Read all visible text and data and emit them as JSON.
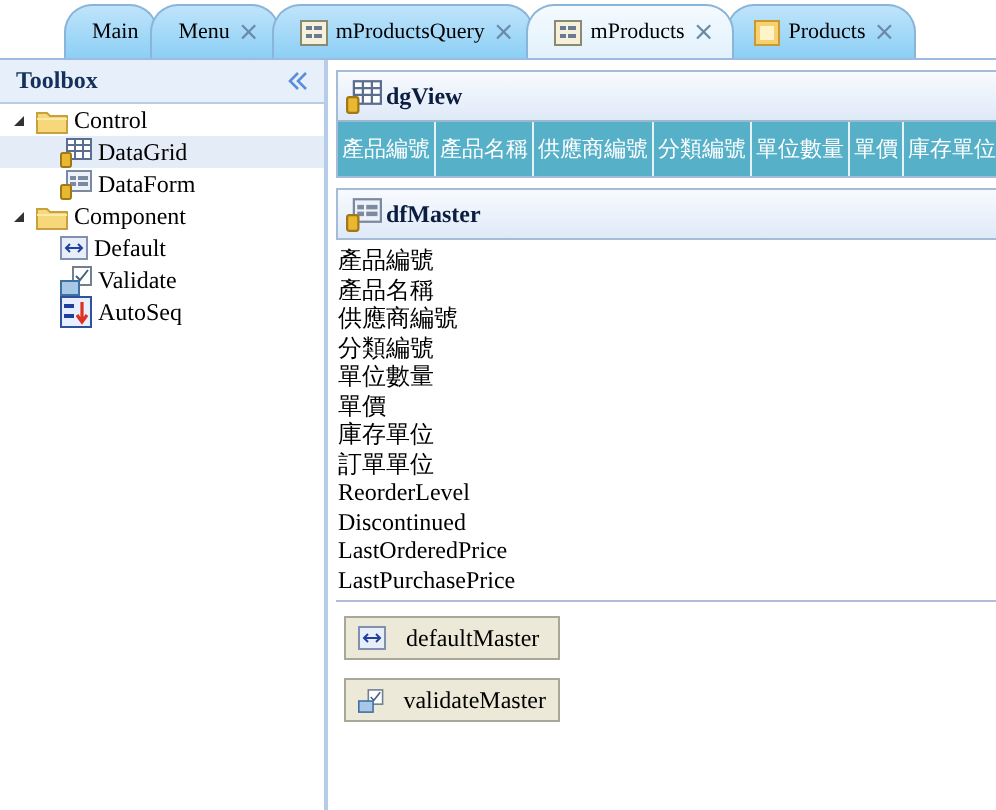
{
  "tabs": [
    {
      "label": "Main",
      "kind": "plain",
      "selected": false
    },
    {
      "label": "Menu",
      "kind": "plain",
      "close": "×",
      "selected": false
    },
    {
      "label": "mProductsQuery",
      "kind": "form",
      "close": "×",
      "selected": false
    },
    {
      "label": "mProducts",
      "kind": "form",
      "close": "×",
      "selected": true
    },
    {
      "label": "Products",
      "kind": "page",
      "close": "×",
      "selected": false
    }
  ],
  "toolbox": {
    "title": "Toolbox",
    "tree": [
      {
        "label": "Control",
        "kind": "folder",
        "expanded": true,
        "selected": false,
        "children": [
          {
            "label": "DataGrid",
            "kind": "grid",
            "selected": true
          },
          {
            "label": "DataForm",
            "kind": "form",
            "selected": false
          }
        ]
      },
      {
        "label": "Component",
        "kind": "folder",
        "expanded": true,
        "selected": false,
        "children": [
          {
            "label": "Default",
            "kind": "default",
            "selected": false
          },
          {
            "label": "Validate",
            "kind": "validate",
            "selected": false
          },
          {
            "label": "AutoSeq",
            "kind": "autoseq",
            "selected": false
          }
        ]
      }
    ]
  },
  "grid_panel": {
    "title": "dgView",
    "columns": [
      "產品編號",
      "產品名稱",
      "供應商編號",
      "分類編號",
      "單位數量",
      "單價",
      "庫存單位"
    ]
  },
  "form_panel": {
    "title": "dfMaster",
    "fields": [
      "產品編號",
      "產品名稱",
      "供應商編號",
      "分類編號",
      "單位數量",
      "單價",
      "庫存單位",
      "訂單單位",
      "ReorderLevel",
      "Discontinued",
      "LastOrderedPrice",
      "LastPurchasePrice"
    ]
  },
  "components": [
    {
      "label": "defaultMaster",
      "kind": "default"
    },
    {
      "label": "validateMaster",
      "kind": "validate"
    }
  ]
}
